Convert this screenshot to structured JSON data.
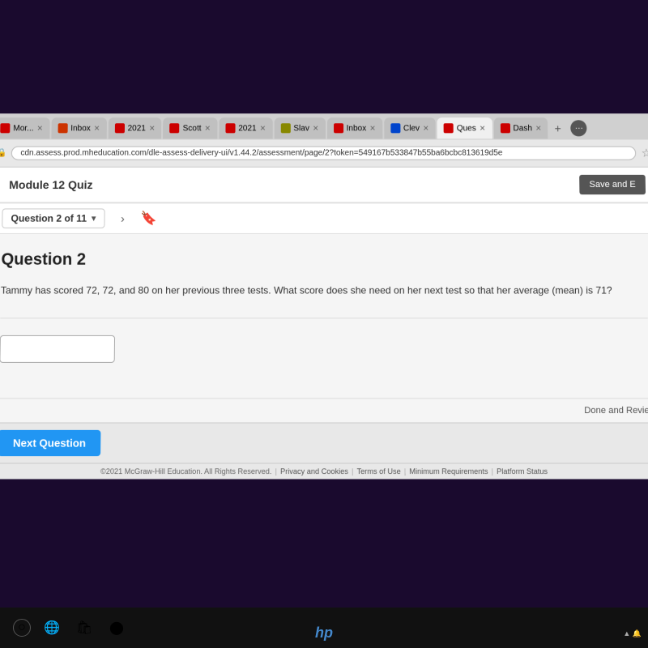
{
  "browser": {
    "url": "cdn.assess.prod.mheducation.com/dle-assess-delivery-ui/v1.44.2/assessment/page/2?token=549167b533847b55ba6bcbc813619d5e",
    "tabs": [
      {
        "label": "Mor",
        "icon_color": "#cc0000",
        "active": false
      },
      {
        "label": "Inbox",
        "icon_color": "#cc3300",
        "active": false
      },
      {
        "label": "2021",
        "icon_color": "#cc0000",
        "active": false
      },
      {
        "label": "Scott",
        "icon_color": "#cc0000",
        "active": false
      },
      {
        "label": "2021",
        "icon_color": "#cc0000",
        "active": false
      },
      {
        "label": "Slavi",
        "icon_color": "#888800",
        "active": false
      },
      {
        "label": "Inbox",
        "icon_color": "#cc0000",
        "active": false
      },
      {
        "label": "Clev",
        "icon_color": "#0044cc",
        "active": false
      },
      {
        "label": "Ques",
        "icon_color": "#cc0000",
        "active": true
      },
      {
        "label": "Dash",
        "icon_color": "#cc0000",
        "active": false
      }
    ]
  },
  "app": {
    "title": "Module 12 Quiz",
    "save_exit_label": "Save and E",
    "red_accent": "#cc0000"
  },
  "question_nav": {
    "selector_label": "Question 2 of 11",
    "chevron": "▾",
    "next_arrow": "›",
    "bookmark": "🔖"
  },
  "question": {
    "title": "Question 2",
    "body": "Tammy has scored 72, 72, and 80 on her previous three tests. What score does she need on her next test so that her average (mean) is 71?",
    "input_placeholder": "",
    "input_value": ""
  },
  "footer": {
    "done_review_label": "Done and Revie",
    "copyright": "©2021 McGraw-Hill Education. All Rights Reserved.",
    "links": [
      "Privacy and Cookies",
      "Terms of Use",
      "Minimum Requirements",
      "Platform Status"
    ]
  },
  "action_bar": {
    "next_question_label": "Next Question"
  },
  "taskbar": {
    "icons": [
      "○",
      "🌐",
      "🛍",
      "⬤"
    ]
  },
  "hp_logo": "hp"
}
